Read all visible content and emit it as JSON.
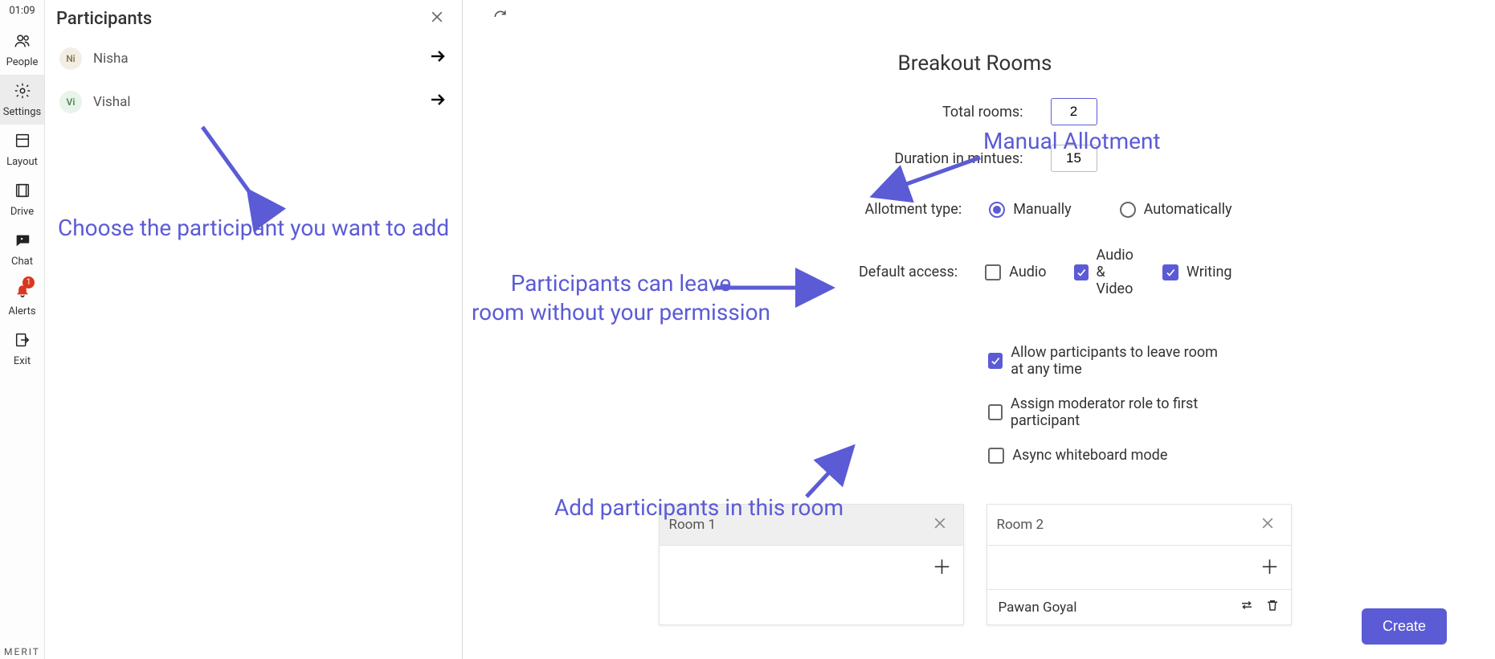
{
  "timer": "01:09",
  "brand": "MERIT",
  "rail": [
    {
      "id": "people",
      "label": "People"
    },
    {
      "id": "settings",
      "label": "Settings"
    },
    {
      "id": "layout",
      "label": "Layout"
    },
    {
      "id": "drive",
      "label": "Drive"
    },
    {
      "id": "chat",
      "label": "Chat"
    },
    {
      "id": "alerts",
      "label": "Alerts",
      "badge": "1"
    },
    {
      "id": "exit",
      "label": "Exit"
    }
  ],
  "participants": {
    "title": "Participants",
    "items": [
      {
        "initials": "Ni",
        "name": "Nisha",
        "avatar_bg": "#f2eee6",
        "avatar_fg": "#8a7a4a"
      },
      {
        "initials": "Vi",
        "name": "Vishal",
        "avatar_bg": "#e8f3e9",
        "avatar_fg": "#4a8a55"
      }
    ]
  },
  "main": {
    "title": "Breakout Rooms",
    "total_rooms_label": "Total rooms:",
    "total_rooms_value": "2",
    "duration_label": "Duration in mintues:",
    "duration_value": "15",
    "allot_label": "Allotment type:",
    "allot_manually": "Manually",
    "allot_automatically": "Automatically",
    "default_access_label": "Default access:",
    "access_audio": "Audio",
    "access_av": "Audio & Video",
    "access_writing": "Writing",
    "opt_leave": "Allow participants to leave room at any time",
    "opt_moderator": "Assign moderator role to first participant",
    "opt_whiteboard": "Async whiteboard mode",
    "rooms": [
      {
        "name": "Room 1",
        "members": []
      },
      {
        "name": "Room 2",
        "members": [
          {
            "name": "Pawan Goyal"
          }
        ]
      }
    ],
    "create_label": "Create"
  },
  "annotations": {
    "choose": "Choose the participant you want to add",
    "manual": "Manual Allotment",
    "leave": "Participants can leave\nroom without your permission",
    "add": "Add participants in this room"
  }
}
